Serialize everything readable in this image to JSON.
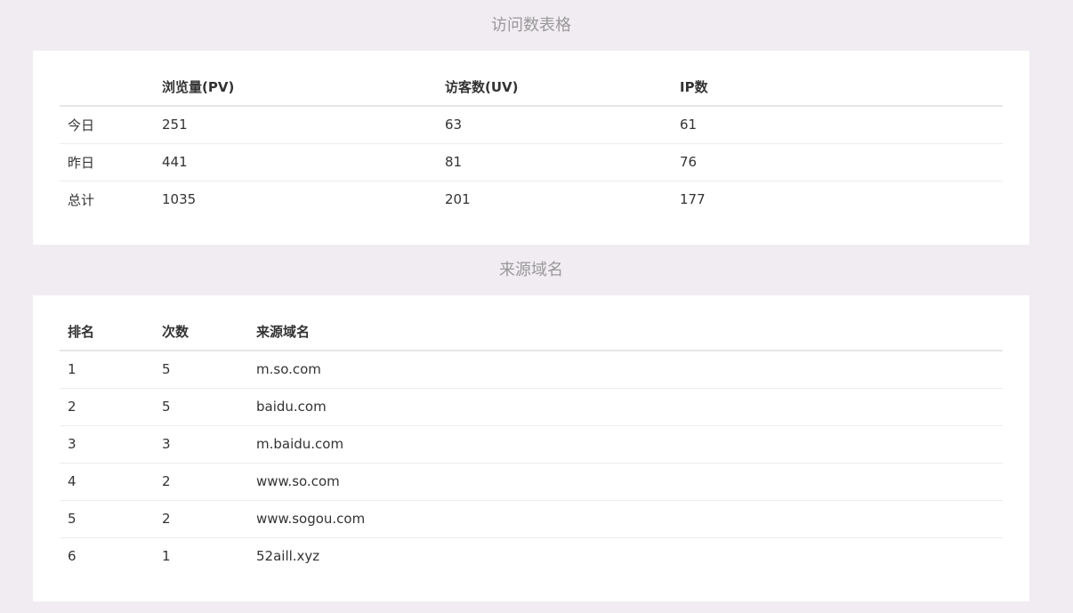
{
  "visits": {
    "title": "访问数表格",
    "headers": [
      "",
      "浏览量(PV)",
      "访客数(UV)",
      "IP数"
    ],
    "rows": [
      {
        "label": "今日",
        "pv": "251",
        "uv": "63",
        "ip": "61"
      },
      {
        "label": "昨日",
        "pv": "441",
        "uv": "81",
        "ip": "76"
      },
      {
        "label": "总计",
        "pv": "1035",
        "uv": "201",
        "ip": "177"
      }
    ]
  },
  "referrers": {
    "title": "来源域名",
    "headers": [
      "排名",
      "次数",
      "来源域名"
    ],
    "rows": [
      {
        "rank": "1",
        "count": "5",
        "domain": "m.so.com"
      },
      {
        "rank": "2",
        "count": "5",
        "domain": "baidu.com"
      },
      {
        "rank": "3",
        "count": "3",
        "domain": "m.baidu.com"
      },
      {
        "rank": "4",
        "count": "2",
        "domain": "www.so.com"
      },
      {
        "rank": "5",
        "count": "2",
        "domain": "www.sogou.com"
      },
      {
        "rank": "6",
        "count": "1",
        "domain": "52aill.xyz"
      }
    ]
  }
}
